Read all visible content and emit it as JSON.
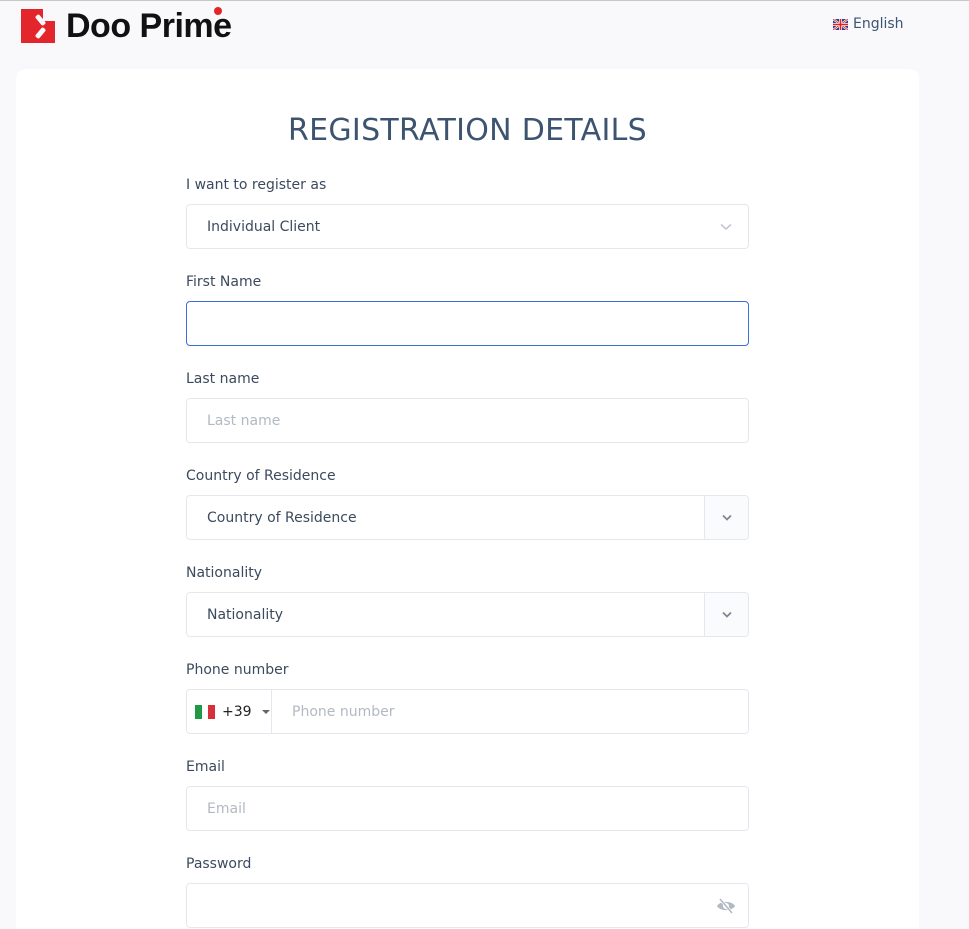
{
  "header": {
    "brand": "Doo Prime",
    "language": "English",
    "language_flag": "uk-flag"
  },
  "form": {
    "title": "REGISTRATION DETAILS",
    "register_as": {
      "label": "I want to register as",
      "value": "Individual Client"
    },
    "first_name": {
      "label": "First Name",
      "value": "",
      "placeholder": ""
    },
    "last_name": {
      "label": "Last name",
      "value": "",
      "placeholder": "Last name"
    },
    "country": {
      "label": "Country of Residence",
      "placeholder": "Country of Residence"
    },
    "nationality": {
      "label": "Nationality",
      "placeholder": "Nationality"
    },
    "phone": {
      "label": "Phone number",
      "country_code": "+39",
      "country_flag": "italy-flag",
      "placeholder": "Phone number"
    },
    "email": {
      "label": "Email",
      "placeholder": "Email"
    },
    "password": {
      "label": "Password",
      "value": ""
    }
  },
  "colors": {
    "brand_red": "#e3262c",
    "focus_blue": "#3a6fd8",
    "title": "#3d5470"
  }
}
